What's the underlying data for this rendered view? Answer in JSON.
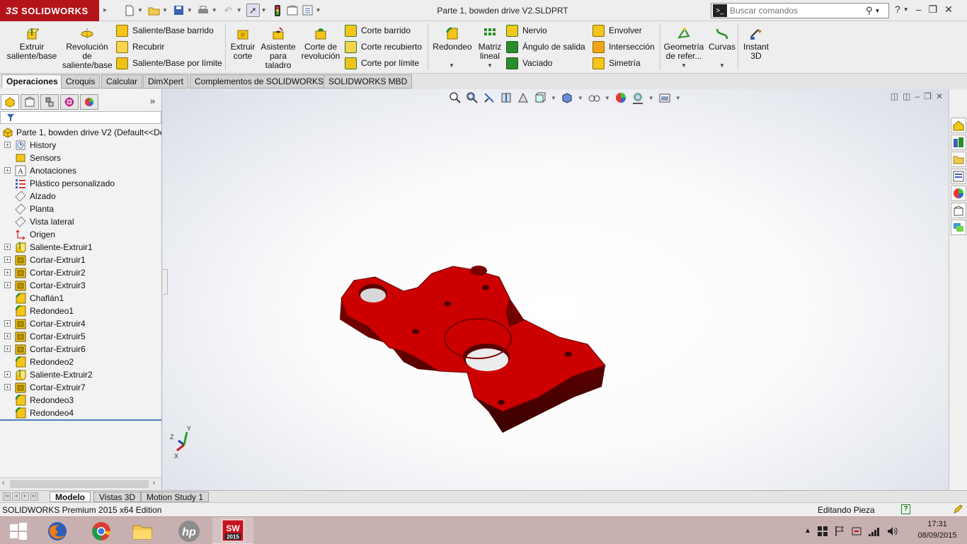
{
  "app": {
    "logo_text": "SOLIDWORKS",
    "logo_mark": "3S",
    "document_title": "Parte 1, bowden drive V2.SLDPRT",
    "search_placeholder": "Buscar comandos",
    "help_glyph": "?"
  },
  "ribbon": {
    "big_buttons": [
      {
        "name": "extrude-boss-button",
        "label": "Extruir\nsaliente/base"
      },
      {
        "name": "revolve-boss-button",
        "label": "Revolución\nde\nsaliente/base"
      },
      {
        "name": "extruded-cut-button",
        "label": "Extruir\ncorte"
      },
      {
        "name": "hole-wizard-button",
        "label": "Asistente\npara\ntaladro"
      },
      {
        "name": "revolved-cut-button",
        "label": "Corte de\nrevolución"
      },
      {
        "name": "fillet-button",
        "label": "Redondeo"
      },
      {
        "name": "linear-pattern-button",
        "label": "Matriz\nlineal"
      },
      {
        "name": "reference-geometry-button",
        "label": "Geometría\nde refer..."
      },
      {
        "name": "curves-button",
        "label": "Curvas"
      },
      {
        "name": "instant3d-button",
        "label": "Instant\n3D"
      }
    ],
    "small_col1": [
      "Saliente/Base barrido",
      "Recubrir",
      "Saliente/Base por límite"
    ],
    "small_col2": [
      "Corte barrido",
      "Corte recubierto",
      "Corte por límite"
    ],
    "small_col3": [
      "Nervio",
      "Ángulo de salida",
      "Vaciado"
    ],
    "small_col4": [
      "Envolver",
      "Intersección",
      "Simetría"
    ]
  },
  "tabs": [
    "Operaciones",
    "Croquis",
    "Calcular",
    "DimXpert",
    "Complementos de SOLIDWORKS",
    "SOLIDWORKS MBD"
  ],
  "feature_tree": {
    "root": "Parte 1, bowden drive V2  (Default<<De",
    "items": [
      {
        "label": "History",
        "icon": "history-icon",
        "expandable": true
      },
      {
        "label": "Sensors",
        "icon": "sensor-icon",
        "expandable": false
      },
      {
        "label": "Anotaciones",
        "icon": "annotations-icon",
        "expandable": true
      },
      {
        "label": "Plástico personalizado",
        "icon": "material-icon",
        "expandable": false
      },
      {
        "label": "Alzado",
        "icon": "plane-icon",
        "expandable": false
      },
      {
        "label": "Planta",
        "icon": "plane-icon",
        "expandable": false
      },
      {
        "label": "Vista lateral",
        "icon": "plane-icon",
        "expandable": false
      },
      {
        "label": "Origen",
        "icon": "origin-icon",
        "expandable": false
      },
      {
        "label": "Saliente-Extruir1",
        "icon": "extrude-icon",
        "expandable": true
      },
      {
        "label": "Cortar-Extruir1",
        "icon": "cut-icon",
        "expandable": true
      },
      {
        "label": "Cortar-Extruir2",
        "icon": "cut-icon",
        "expandable": true
      },
      {
        "label": "Cortar-Extruir3",
        "icon": "cut-icon",
        "expandable": true
      },
      {
        "label": "Chaflán1",
        "icon": "chamfer-icon",
        "expandable": false
      },
      {
        "label": "Redondeo1",
        "icon": "fillet-icon",
        "expandable": false
      },
      {
        "label": "Cortar-Extruir4",
        "icon": "cut-icon",
        "expandable": true
      },
      {
        "label": "Cortar-Extruir5",
        "icon": "cut-icon",
        "expandable": true
      },
      {
        "label": "Cortar-Extruir6",
        "icon": "cut-icon",
        "expandable": true
      },
      {
        "label": "Redondeo2",
        "icon": "fillet-icon",
        "expandable": false
      },
      {
        "label": "Saliente-Extruir2",
        "icon": "extrude-icon",
        "expandable": true
      },
      {
        "label": "Cortar-Extruir7",
        "icon": "cut-icon",
        "expandable": true
      },
      {
        "label": "Redondeo3",
        "icon": "fillet-icon",
        "expandable": false
      },
      {
        "label": "Redondeo4",
        "icon": "fillet-icon",
        "expandable": false
      }
    ]
  },
  "bottom_tabs": [
    "Modelo",
    "Vistas 3D",
    "Motion Study 1"
  ],
  "status": {
    "left": "SOLIDWORKS Premium 2015 x64 Edition",
    "right": "Editando Pieza"
  },
  "triad": {
    "x": "X",
    "y": "Y",
    "z": "Z"
  },
  "taskbar": {
    "time": "17:31",
    "date": "08/09/2015",
    "sw_badge": "2015"
  },
  "colors": {
    "brand_red": "#b4131a",
    "part_red": "#c00000",
    "taskbar": "#c9b0b0"
  }
}
